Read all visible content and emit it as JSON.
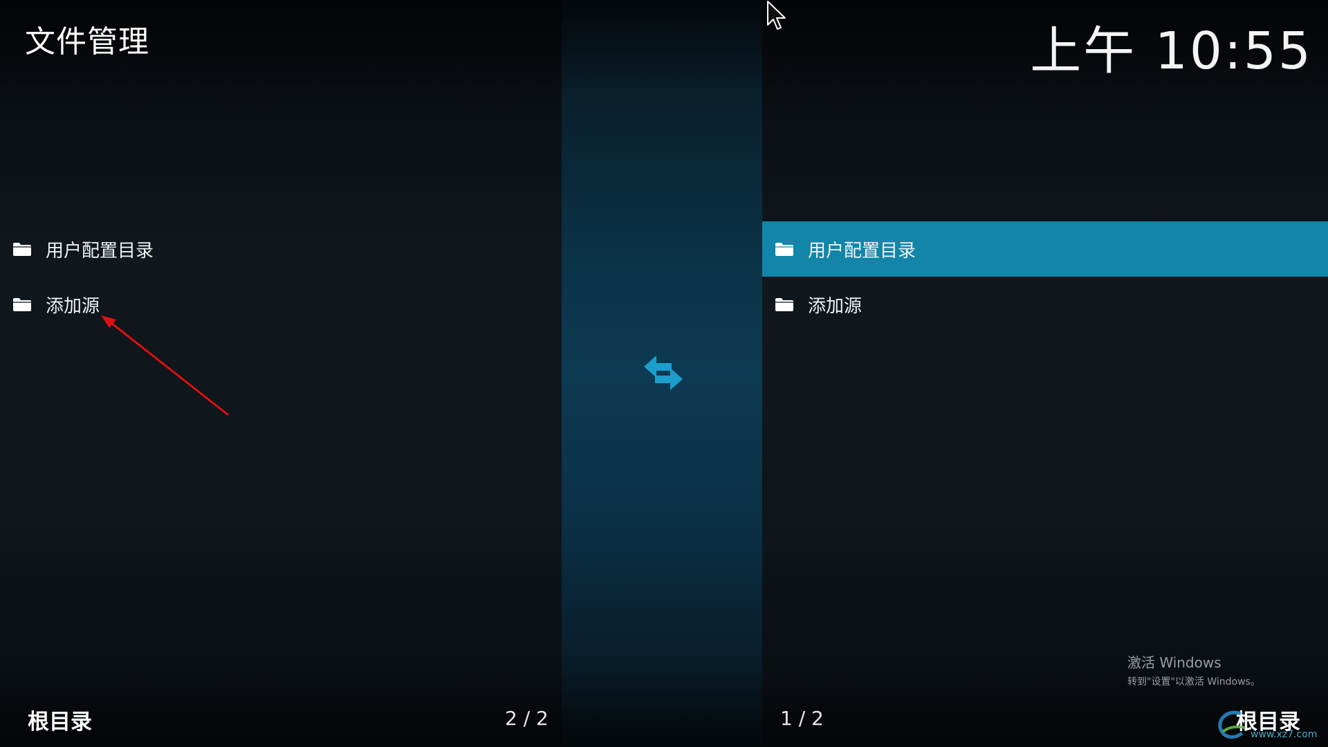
{
  "header": {
    "title": "文件管理",
    "clock": "上午 10:55"
  },
  "left_pane": {
    "items": [
      {
        "label": "用户配置目录",
        "icon": "folder-icon"
      },
      {
        "label": "添加源",
        "icon": "folder-icon"
      }
    ],
    "footer_label": "根目录",
    "footer_count": "2 / 2"
  },
  "right_pane": {
    "items": [
      {
        "label": "用户配置目录",
        "icon": "folder-icon",
        "selected": true
      },
      {
        "label": "添加源",
        "icon": "folder-icon"
      }
    ],
    "footer_label": "根目录",
    "footer_count": "1 / 2"
  },
  "center": {
    "icon": "swap-arrows-icon"
  },
  "watermark": {
    "title": "激活 Windows",
    "subtitle": "转到\"设置\"以激活 Windows。"
  },
  "site_logo": {
    "url": "www.xz7.com"
  },
  "colors": {
    "accent": "#1285a9",
    "center_strip": "#0c3a52",
    "annotation": "#e01010",
    "swap_icon": "#1a9fcc"
  }
}
